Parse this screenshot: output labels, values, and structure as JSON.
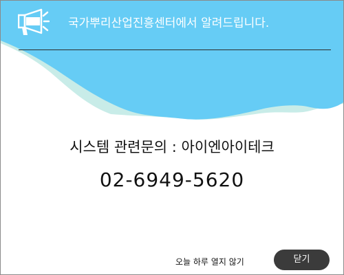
{
  "header": {
    "title": "국가뿌리산업진흥센터에서 알려드립니다.",
    "icon": "megaphone-icon"
  },
  "body": {
    "contact_label": "시스템 관련문의 : 아이엔아이테크",
    "phone": "02-6949-5620"
  },
  "footer": {
    "dont_show_today_label": "오늘 하루 열지 않기",
    "close_label": "닫기"
  },
  "colors": {
    "header_blue": "#66ccf5",
    "wave_teal": "#c8ece8",
    "close_button_bg": "#3b3b3b"
  }
}
